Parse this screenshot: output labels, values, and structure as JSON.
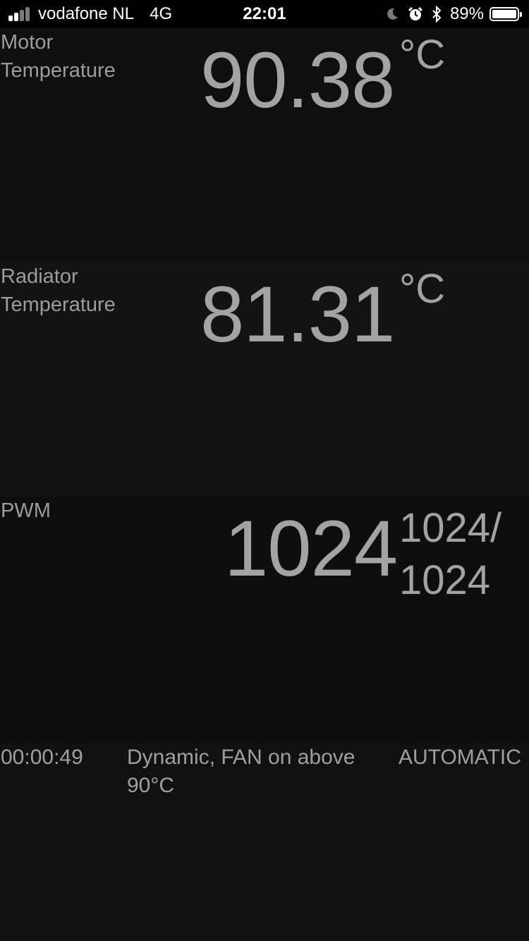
{
  "status_bar": {
    "carrier": "vodafone NL",
    "network": "4G",
    "time": "22:01",
    "battery_percent": "89%",
    "signal_bars": 4,
    "signal_bars_filled": 2,
    "icons": [
      "moon-icon",
      "alarm-icon",
      "bluetooth-icon",
      "battery-icon"
    ]
  },
  "motor": {
    "label": "Motor Temperature",
    "value": "90.38",
    "unit": "°C"
  },
  "radiator": {
    "label": "Radiator Temperature",
    "value": "81.31",
    "unit": "°C"
  },
  "pwm": {
    "label": "PWM",
    "value": "1024",
    "detail": "1024/ 1024"
  },
  "footer": {
    "elapsed": "00:00:49",
    "mode_description": "Dynamic, FAN on above 90°C",
    "mode": "AUTOMATIC"
  },
  "colors": {
    "background": "#0d0d0d",
    "text": "#a3a3a3",
    "status_bar_bg": "#000000"
  }
}
